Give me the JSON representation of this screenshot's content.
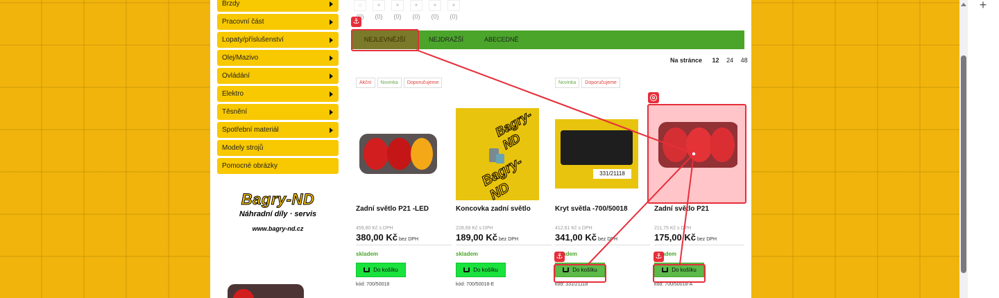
{
  "categories": [
    {
      "label": "Brzdy"
    },
    {
      "label": "Pracovní část"
    },
    {
      "label": "Lopaty/příslušenství"
    },
    {
      "label": "Olej/Mazivo"
    },
    {
      "label": "Ovládání"
    },
    {
      "label": "Elektro"
    },
    {
      "label": "Těsnění"
    },
    {
      "label": "Spotřební materiál"
    },
    {
      "label": "Modely strojů"
    },
    {
      "label": "Pomocné obrázky"
    }
  ],
  "logo": {
    "brand": "Bagry-ND",
    "tagline": "Náhradní díly · servis",
    "url": "www.bagry-nd.cz"
  },
  "ratings": [
    {
      "count": "(0)",
      "symbol": "☆"
    },
    {
      "count": "(0)",
      "symbol": "✦"
    },
    {
      "count": "(0)",
      "symbol": "✦"
    },
    {
      "count": "(0)",
      "symbol": "✦"
    },
    {
      "count": "(0)",
      "symbol": "✦"
    },
    {
      "count": "(0)",
      "symbol": "✦"
    }
  ],
  "sort": {
    "tabs": [
      "NEJLEVNĚJŠÍ",
      "NEJDRAŽŠÍ",
      "ABECEDNĚ"
    ],
    "active": "NEJLEVNĚJŠÍ"
  },
  "perpage": {
    "label": "Na stránce",
    "options": [
      "12",
      "24",
      "48"
    ],
    "selected": "12"
  },
  "products": [
    {
      "tags": [
        {
          "text": "Akční",
          "color": "red"
        },
        {
          "text": "Novinka",
          "color": "green"
        },
        {
          "text": "Doporučujeme",
          "color": "red"
        }
      ],
      "name": "Zadní světlo P21 -LED",
      "old_price": "459,80 Kč s DPH",
      "price": "380,00 Kč",
      "price_note": "bez DPH",
      "stock": "skladem",
      "cart_label": "Do košíku",
      "code": "kód: 700/50018"
    },
    {
      "tags": [],
      "name": "Koncovka zadní světlo",
      "old_price": "228,69 Kč s DPH",
      "price": "189,00 Kč",
      "price_note": "bez DPH",
      "stock": "skladem",
      "cart_label": "Do košíku",
      "code": "kód: 700/50018-E"
    },
    {
      "tags": [
        {
          "text": "Novinka",
          "color": "green"
        },
        {
          "text": "Doporučujeme",
          "color": "red"
        }
      ],
      "name": "Kryt světla -700/50018",
      "old_price": "412,61 Kč s DPH",
      "price": "341,00 Kč",
      "price_note": "bez DPH",
      "stock": "skladem",
      "cart_label": "Do košíku",
      "code": "kód: 331/21118"
    },
    {
      "tags": [],
      "name": "Zadní světlo P21",
      "old_price": "211,75 Kč s DPH",
      "price": "175,00 Kč",
      "price_note": "bez DPH",
      "stock": "skladem",
      "cart_label": "Do košíku",
      "code": "kód: 700/50018-A"
    }
  ],
  "image_texts": {
    "bagry_watermark": "Bagry-ND",
    "cover_label": "331/21118"
  },
  "colors": {
    "accent_yellow": "#f8c800",
    "sort_green": "#4aa52a",
    "cart_green": "#19e23c",
    "annotation_red": "#e62e3a"
  }
}
